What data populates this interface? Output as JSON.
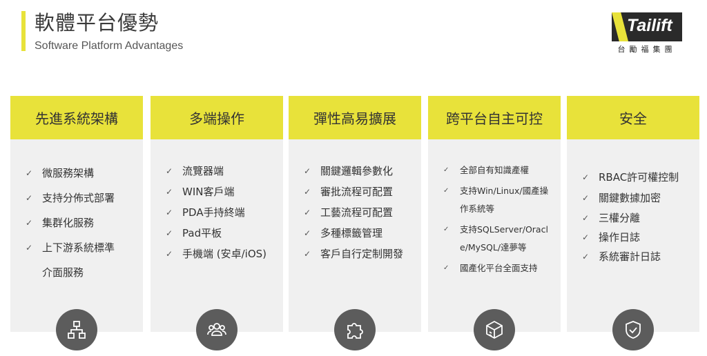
{
  "header": {
    "title_zh": "軟體平台優勢",
    "title_en": "Software Platform Advantages"
  },
  "logo": {
    "text": "Tailift",
    "sub": "台勵福集團"
  },
  "colors": {
    "accent": "#e8e23a",
    "card_bg": "#f0f0f0",
    "icon_bg": "#5c5c5c"
  },
  "cards": [
    {
      "title": "先進系統架構",
      "icon": "sitemap-icon",
      "items": [
        "微服務架構",
        "支持分佈式部署",
        "集群化服務",
        "上下游系統標準介面服務"
      ]
    },
    {
      "title": "多端操作",
      "icon": "users-icon",
      "items": [
        "流覽器端",
        "WIN客戶端",
        "PDA手持終端",
        "Pad平板",
        "手機端 (安卓/iOS)"
      ]
    },
    {
      "title": "彈性高易擴展",
      "icon": "puzzle-icon",
      "items": [
        "關鍵邏輯參數化",
        "審批流程可配置",
        "工藝流程可配置",
        "多種標籤管理",
        "客戶自行定制開發"
      ]
    },
    {
      "title": "跨平台自主可控",
      "icon": "cube-icon",
      "items": [
        "全部自有知識產權",
        "支持Win/Linux/國產操作系統等",
        "支持SQLServer/Oracle/MySQL/達夢等",
        "國產化平台全面支持"
      ]
    },
    {
      "title": "安全",
      "icon": "shield-check-icon",
      "items": [
        "RBAC許可權控制",
        "關鍵數據加密",
        "三權分離",
        "操作日誌",
        "系統審計日誌"
      ]
    }
  ]
}
